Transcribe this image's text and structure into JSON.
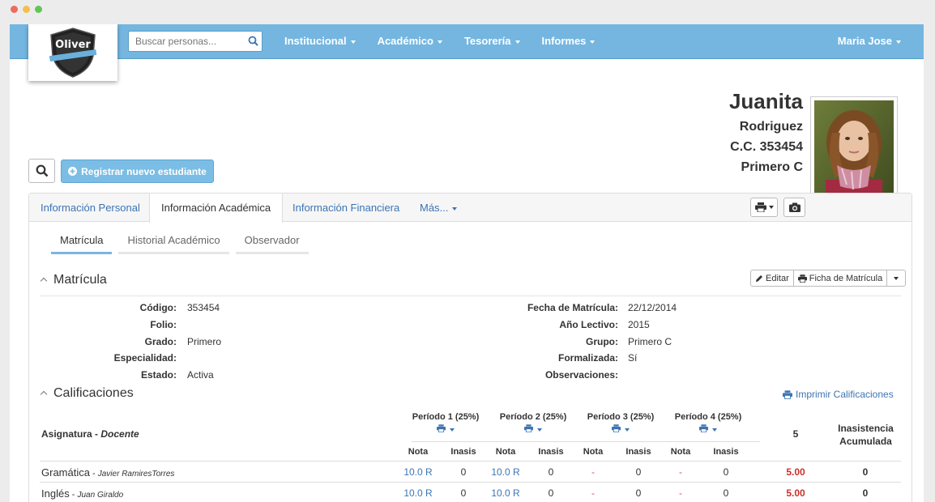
{
  "window": {
    "dots": [
      "#ee6a5f",
      "#f5be4f",
      "#62c655"
    ]
  },
  "navbar": {
    "logo_text": "Oliver",
    "search_placeholder": "Buscar personas...",
    "menus": [
      "Institucional",
      "Académico",
      "Tesorería",
      "Informes"
    ],
    "user": "Maria Jose",
    "color": "#74b6e0"
  },
  "student": {
    "first_name": "Juanita",
    "last_name": "Rodriguez",
    "id": "C.C. 353454",
    "group": "Primero C"
  },
  "actions": {
    "new_student": "Registrar nuevo estudiante"
  },
  "tabs": [
    "Información Personal",
    "Información Académica",
    "Información Financiera",
    "Más..."
  ],
  "subtabs": [
    "Matrícula",
    "Historial Académico",
    "Observador"
  ],
  "matricula": {
    "title": "Matrícula",
    "edit": "Editar",
    "ficha": "Ficha de Matrícula",
    "left": [
      {
        "label": "Código:",
        "value": "353454"
      },
      {
        "label": "Folio:",
        "value": ""
      },
      {
        "label": "Grado:",
        "value": "Primero"
      },
      {
        "label": "Especialidad:",
        "value": ""
      },
      {
        "label": "Estado:",
        "value": "Activa"
      }
    ],
    "right": [
      {
        "label": "Fecha de Matrícula:",
        "value": "22/12/2014"
      },
      {
        "label": "Año Lectivo:",
        "value": "2015"
      },
      {
        "label": "Grupo:",
        "value": "Primero C"
      },
      {
        "label": "Formalizada:",
        "value": "Sí"
      },
      {
        "label": "Observaciones:",
        "value": ""
      }
    ]
  },
  "calificaciones": {
    "title": "Calificaciones",
    "print": "Imprimir Calificaciones",
    "subject_header": "Asignatura",
    "teacher_header": "Docente",
    "periods": [
      "Período 1 (25%)",
      "Período 2 (25%)",
      "Período 3 (25%)",
      "Período 4 (25%)"
    ],
    "nota": "Nota",
    "inasis": "Inasis",
    "total_header": "5",
    "absence_header": [
      "Inasistencia",
      "Acumulada"
    ],
    "rows": [
      {
        "subject": "Gramática",
        "teacher": "Javier RamiresTorres",
        "cells": [
          "10.0 R",
          "0",
          "10.0 R",
          "0",
          "-",
          "0",
          "-",
          "0"
        ],
        "total": "5.00",
        "absence": "0"
      },
      {
        "subject": "Inglés",
        "teacher": "Juan Giraldo",
        "cells": [
          "10.0 R",
          "0",
          "10.0 R",
          "0",
          "-",
          "0",
          "-",
          "0"
        ],
        "total": "5.00",
        "absence": "0"
      }
    ]
  }
}
